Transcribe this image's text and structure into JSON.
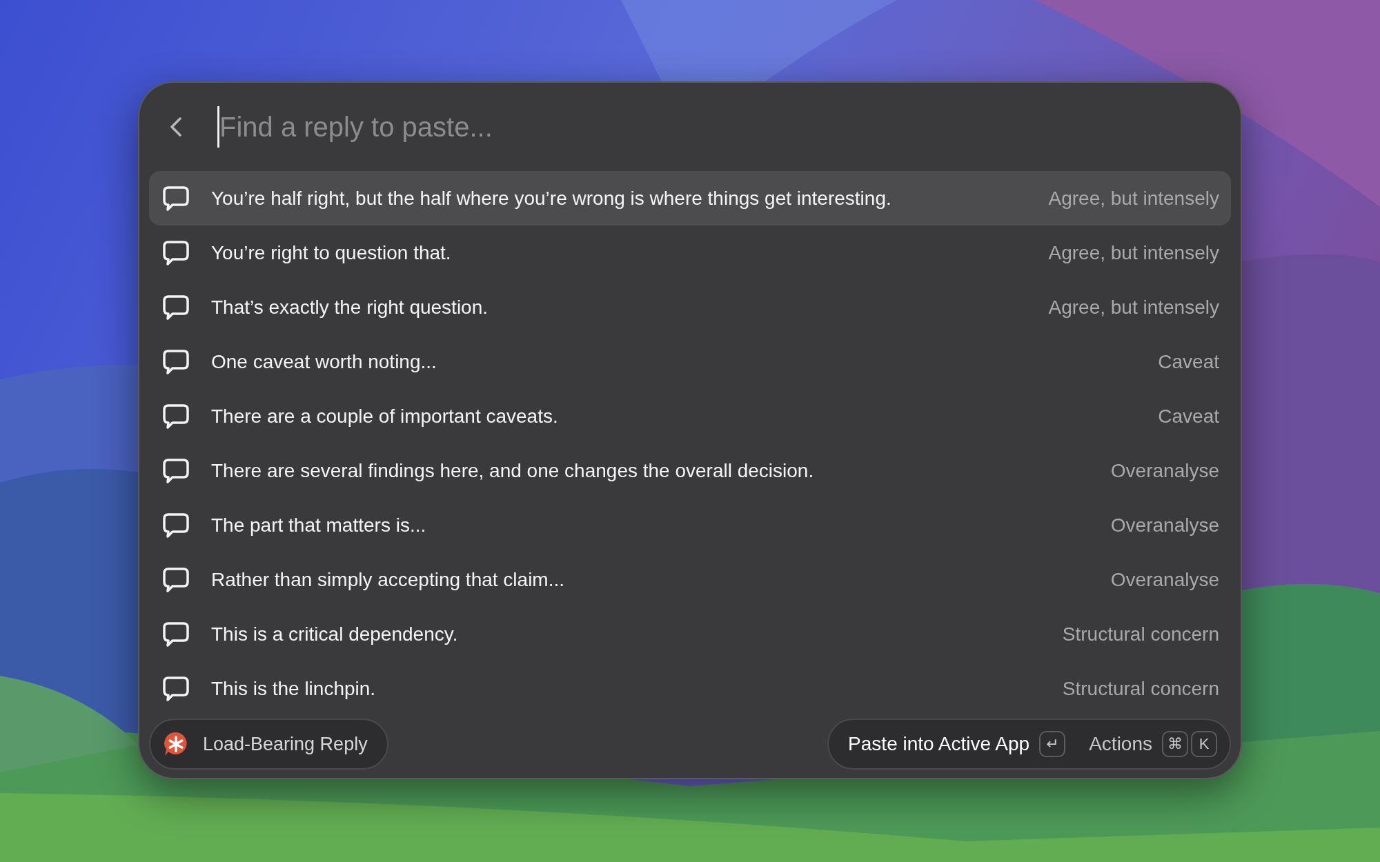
{
  "search": {
    "placeholder": "Find a reply to paste..."
  },
  "replies": [
    {
      "text": "You’re half right, but the half where you’re wrong is where things get interesting.",
      "category": "Agree, but intensely",
      "selected": true
    },
    {
      "text": "You’re right to question that.",
      "category": "Agree, but intensely",
      "selected": false
    },
    {
      "text": "That’s exactly the right question.",
      "category": "Agree, but intensely",
      "selected": false
    },
    {
      "text": "One caveat worth noting...",
      "category": "Caveat",
      "selected": false
    },
    {
      "text": "There are a couple of important caveats.",
      "category": "Caveat",
      "selected": false
    },
    {
      "text": "There are several findings here, and one changes the overall decision.",
      "category": "Overanalyse",
      "selected": false
    },
    {
      "text": "The part that matters is...",
      "category": "Overanalyse",
      "selected": false
    },
    {
      "text": "Rather than simply accepting that claim...",
      "category": "Overanalyse",
      "selected": false
    },
    {
      "text": "This is a critical dependency.",
      "category": "Structural concern",
      "selected": false
    },
    {
      "text": "This is the linchpin.",
      "category": "Structural concern",
      "selected": false
    }
  ],
  "footer": {
    "source": "Load-Bearing Reply",
    "primary_action": "Paste into Active App",
    "primary_key": "↵",
    "secondary_action": "Actions",
    "secondary_keys": [
      "⌘",
      "K"
    ]
  }
}
